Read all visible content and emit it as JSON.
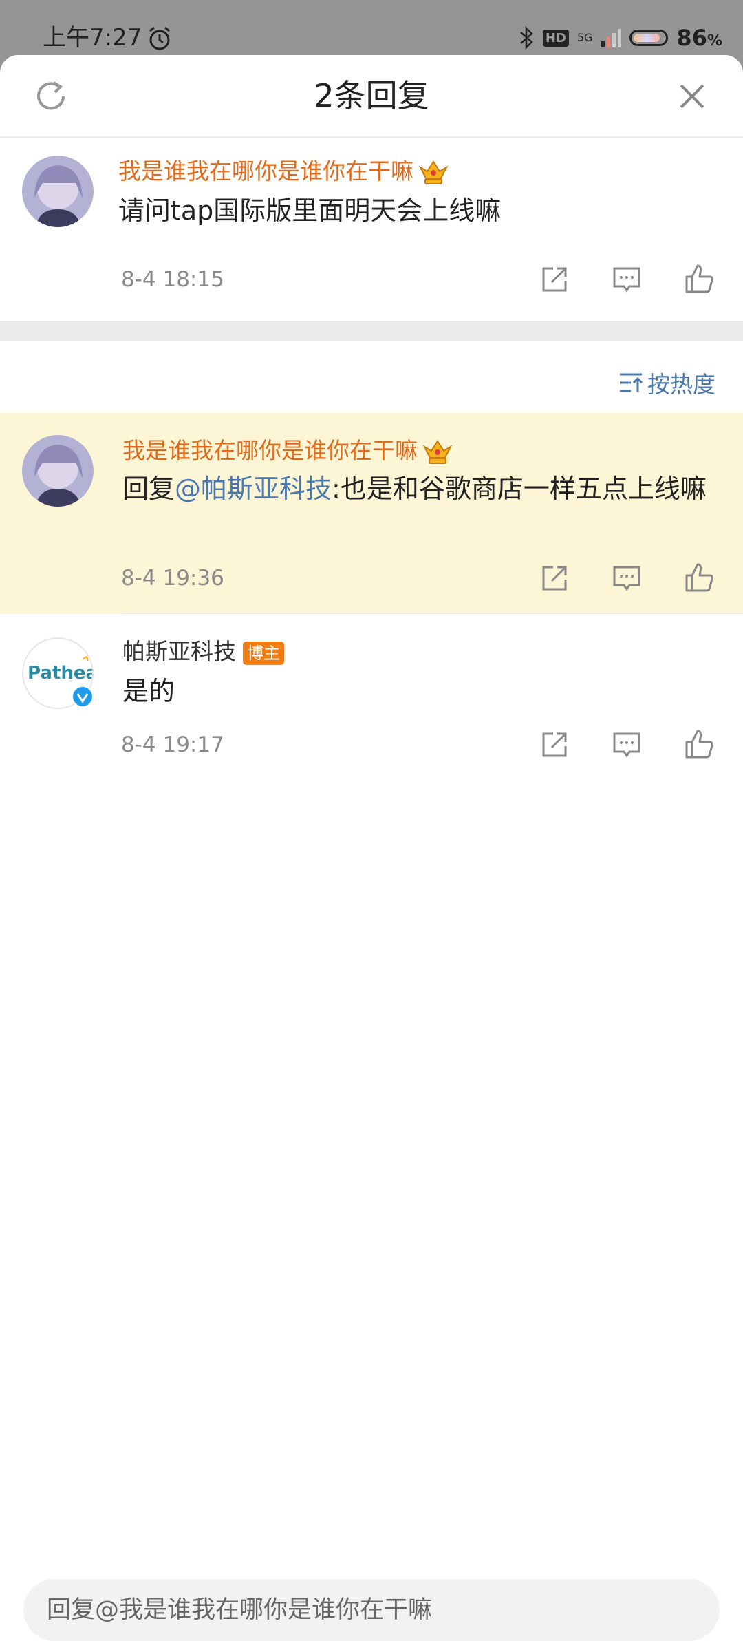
{
  "status_bar": {
    "time": "上午7:27",
    "hd_label": "HD",
    "network_label": "5G",
    "battery_percent": "86",
    "battery_unit": "%",
    "battery_level": 0.86
  },
  "header": {
    "title": "2条回复"
  },
  "root_comment": {
    "username": "我是谁我在哪你是谁你在干嘛",
    "text": "请问tap国际版里面明天会上线嘛",
    "timestamp": "8-4 18:15"
  },
  "sort": {
    "label": "按热度"
  },
  "replies": [
    {
      "username": "我是谁我在哪你是谁你在干嘛",
      "reply_prefix": "回复",
      "mention": "@帕斯亚科技",
      "text": ":也是和谷歌商店一样五点上线嘛",
      "timestamp": "8-4 19:36"
    },
    {
      "username": "帕斯亚科技",
      "badge": "博主",
      "avatar_logo": "Pathea",
      "text": "是的",
      "timestamp": "8-4 19:17"
    }
  ],
  "reply_input": {
    "placeholder": "回复@我是谁我在哪你是谁你在干嘛"
  },
  "colors": {
    "username_vip": "#e06b1b",
    "mention": "#4a78b0",
    "highlight_bg": "#fdf6d6",
    "badge_bg": "#f07d14"
  },
  "icons": [
    "refresh-icon",
    "close-icon",
    "crown-icon",
    "share-icon",
    "comment-icon",
    "like-icon",
    "sort-icon",
    "verified-icon",
    "alarm-icon",
    "bluetooth-icon",
    "signal-icon",
    "battery-icon"
  ]
}
